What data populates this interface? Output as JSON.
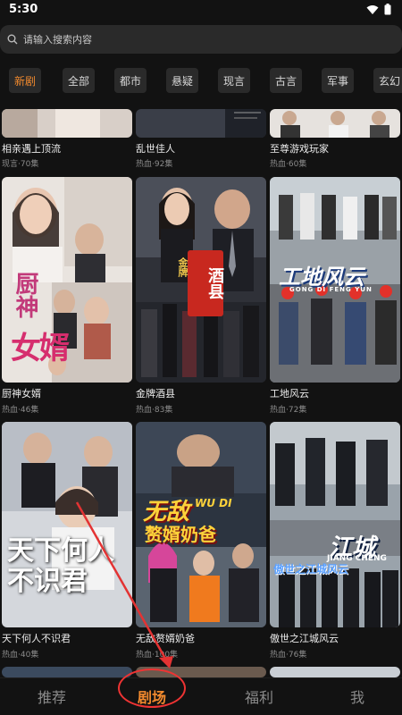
{
  "status_bar": {
    "time": "5:30"
  },
  "search": {
    "placeholder": "请输入搜索内容"
  },
  "tabs": [
    {
      "label": "新剧",
      "active": true
    },
    {
      "label": "全部"
    },
    {
      "label": "都市"
    },
    {
      "label": "悬疑"
    },
    {
      "label": "现言"
    },
    {
      "label": "古言"
    },
    {
      "label": "军事"
    },
    {
      "label": "玄幻"
    }
  ],
  "cards": [
    {
      "title": "相亲遇上顶流",
      "meta": "现言·70集"
    },
    {
      "title": "乱世佳人",
      "meta": "热血·92集"
    },
    {
      "title": "至尊游戏玩家",
      "meta": "热血·60集"
    },
    {
      "title": "厨神女婿",
      "meta": "热血·46集",
      "poster_text": "厨神女婿"
    },
    {
      "title": "金牌酒县",
      "meta": "热血·83集",
      "poster_text": "金牌酒县"
    },
    {
      "title": "工地风云",
      "meta": "热血·72集",
      "poster_text": "工地风云",
      "poster_sub": "GONG DI FENG YUN"
    },
    {
      "title": "天下何人不识君",
      "meta": "热血·40集",
      "poster_text": "天下何人不识君"
    },
    {
      "title": "无敌赘婿奶爸",
      "meta": "热血·100集",
      "poster_text": "无敌赘婿奶爸",
      "poster_sub": "WU DI"
    },
    {
      "title": "傲世之江城风云",
      "meta": "热血·76集",
      "poster_text": "江城",
      "poster_sub": "JIANG CHENG"
    }
  ],
  "bottom_nav": [
    {
      "label": "推荐"
    },
    {
      "label": "剧场",
      "active": true
    },
    {
      "label": "福利"
    },
    {
      "label": "我"
    }
  ],
  "colors": {
    "accent": "#f28a2e",
    "background": "#121212",
    "annotation": "#e33333"
  }
}
